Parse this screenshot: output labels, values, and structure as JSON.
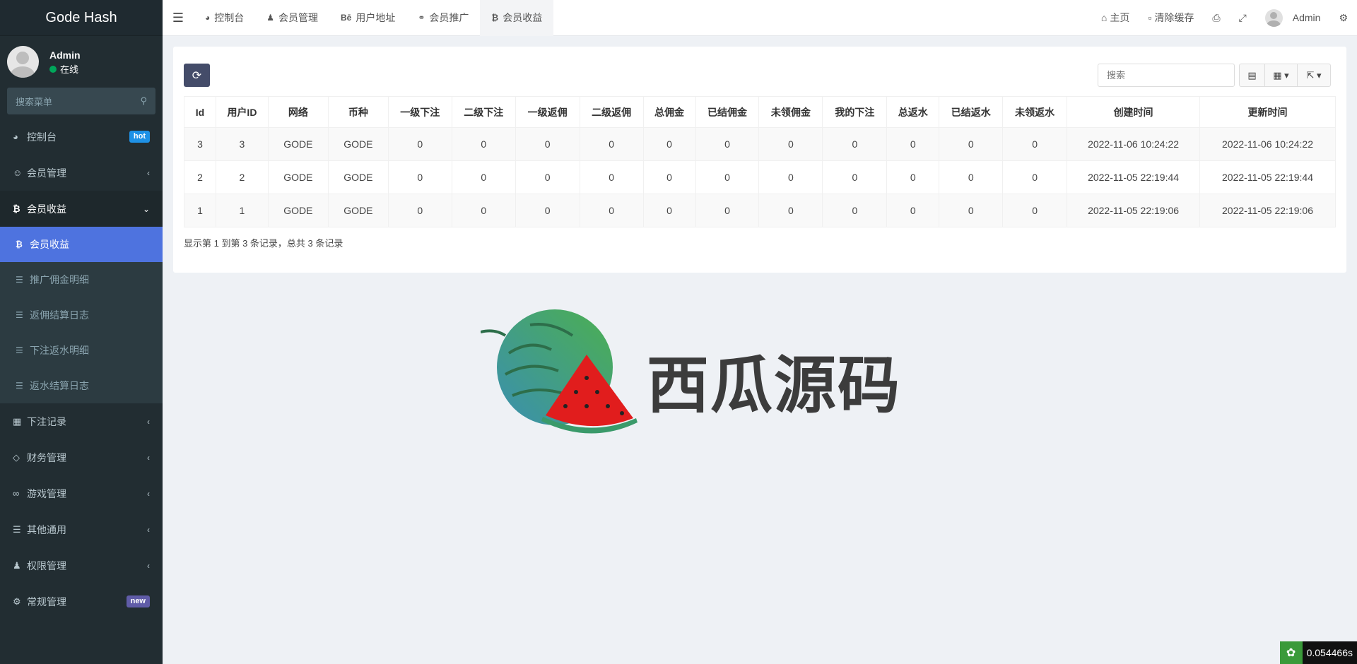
{
  "sidebar": {
    "brand": "Gode Hash",
    "user": {
      "name": "Admin",
      "status": "在线"
    },
    "search_placeholder": "搜索菜单",
    "items": [
      {
        "icon": "dashboard-icon",
        "label": "控制台",
        "badge": "hot"
      },
      {
        "icon": "user-circle-icon",
        "label": "会员管理"
      },
      {
        "icon": "bitcoin-icon",
        "label": "会员收益"
      },
      {
        "icon": "calendar-icon",
        "label": "下注记录"
      },
      {
        "icon": "diamond-icon",
        "label": "财务管理"
      },
      {
        "icon": "gamepad-icon",
        "label": "游戏管理"
      },
      {
        "icon": "list-icon",
        "label": "其他通用"
      },
      {
        "icon": "users-icon",
        "label": "权限管理"
      },
      {
        "icon": "cogs-icon",
        "label": "常规管理",
        "badge": "new"
      }
    ],
    "submenu": [
      {
        "icon": "bitcoin-icon",
        "label": "会员收益",
        "active": true
      },
      {
        "icon": "list-icon",
        "label": "推广佣金明细"
      },
      {
        "icon": "list-icon",
        "label": "返佣结算日志"
      },
      {
        "icon": "list-icon",
        "label": "下注返水明细"
      },
      {
        "icon": "list-icon",
        "label": "返水结算日志"
      }
    ]
  },
  "topbar": {
    "tabs": [
      {
        "icon": "dashboard-icon",
        "label": "控制台"
      },
      {
        "icon": "user-circle-icon",
        "label": "会员管理"
      },
      {
        "icon": "behance-icon",
        "icon_text": "Bē",
        "label": "用户地址"
      },
      {
        "icon": "handshake-icon",
        "label": "会员推广"
      },
      {
        "icon": "bitcoin-icon",
        "label": "会员收益",
        "active": true
      }
    ],
    "right": {
      "home": "主页",
      "clear_cache": "清除缓存",
      "user": "Admin"
    }
  },
  "table": {
    "search_placeholder": "搜索",
    "columns": [
      "Id",
      "用户ID",
      "网络",
      "币种",
      "一级下注",
      "二级下注",
      "一级返佣",
      "二级返佣",
      "总佣金",
      "已结佣金",
      "未领佣金",
      "我的下注",
      "总返水",
      "已结返水",
      "未领返水",
      "创建时间",
      "更新时间"
    ],
    "rows": [
      [
        "3",
        "3",
        "GODE",
        "GODE",
        "0",
        "0",
        "0",
        "0",
        "0",
        "0",
        "0",
        "0",
        "0",
        "0",
        "0",
        "2022-11-06 10:24:22",
        "2022-11-06 10:24:22"
      ],
      [
        "2",
        "2",
        "GODE",
        "GODE",
        "0",
        "0",
        "0",
        "0",
        "0",
        "0",
        "0",
        "0",
        "0",
        "0",
        "0",
        "2022-11-05 22:19:44",
        "2022-11-05 22:19:44"
      ],
      [
        "1",
        "1",
        "GODE",
        "GODE",
        "0",
        "0",
        "0",
        "0",
        "0",
        "0",
        "0",
        "0",
        "0",
        "0",
        "0",
        "2022-11-05 22:19:06",
        "2022-11-05 22:19:06"
      ]
    ],
    "pagination_info": "显示第 1 到第 3 条记录，总共 3 条记录"
  },
  "watermark": {
    "text": "西瓜源码"
  },
  "timer": {
    "value": "0.054466s"
  }
}
